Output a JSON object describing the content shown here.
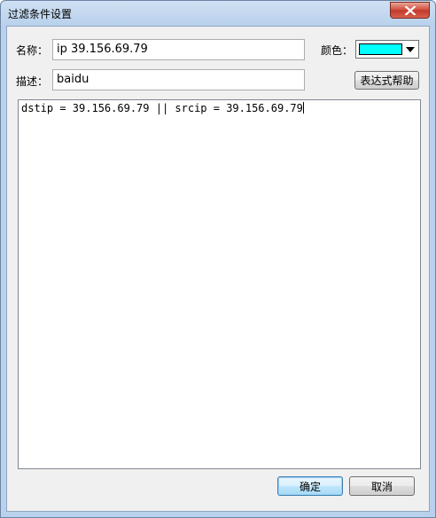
{
  "window": {
    "title": "过滤条件设置",
    "close_symbol": "✕"
  },
  "form": {
    "name_label": "名称：",
    "name_value": "ip 39.156.69.79",
    "color_label": "颜色：",
    "color_value": "#00ffff",
    "desc_label": "描述：",
    "desc_value": "baidu",
    "expr_help_label": "表达式帮助",
    "expression": "dstip = 39.156.69.79 || srcip = 39.156.69.79"
  },
  "footer": {
    "ok_label": "确定",
    "cancel_label": "取消"
  },
  "icons": [
    "close-icon",
    "dropdown-arrow-icon"
  ]
}
